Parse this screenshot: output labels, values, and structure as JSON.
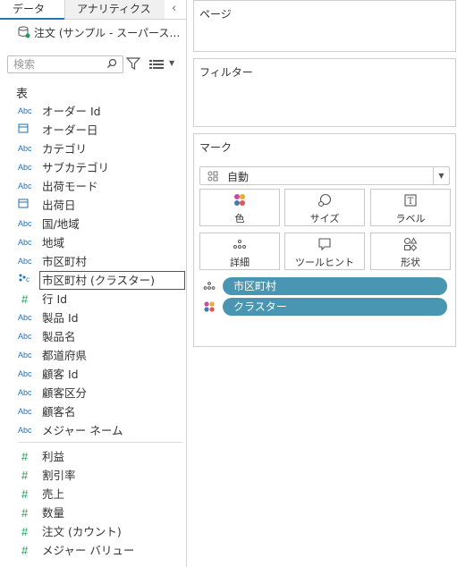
{
  "tabs": {
    "data": "データ",
    "analytics": "アナリティクス"
  },
  "data_source": "注文 (サンプル - スーパース…",
  "search": {
    "placeholder": "検索"
  },
  "section_table": "表",
  "dimensions": [
    {
      "type": "abc",
      "icon_text": "Abc",
      "label": "オーダー Id"
    },
    {
      "type": "date",
      "icon_text": "",
      "label": "オーダー日"
    },
    {
      "type": "abc",
      "icon_text": "Abc",
      "label": "カテゴリ"
    },
    {
      "type": "abc",
      "icon_text": "Abc",
      "label": "サブカテゴリ"
    },
    {
      "type": "abc",
      "icon_text": "Abc",
      "label": "出荷モード"
    },
    {
      "type": "date",
      "icon_text": "",
      "label": "出荷日"
    },
    {
      "type": "abc",
      "icon_text": "Abc",
      "label": "国/地域"
    },
    {
      "type": "abc",
      "icon_text": "Abc",
      "label": "地域"
    },
    {
      "type": "abc",
      "icon_text": "Abc",
      "label": "市区町村"
    },
    {
      "type": "cluster",
      "icon_text": "",
      "label": "市区町村 (クラスター)",
      "selected": true
    },
    {
      "type": "num",
      "icon_text": "#",
      "label": "行 Id"
    },
    {
      "type": "abc",
      "icon_text": "Abc",
      "label": "製品 Id"
    },
    {
      "type": "abc",
      "icon_text": "Abc",
      "label": "製品名"
    },
    {
      "type": "abc",
      "icon_text": "Abc",
      "label": "都道府県"
    },
    {
      "type": "abc",
      "icon_text": "Abc",
      "label": "顧客 Id"
    },
    {
      "type": "abc",
      "icon_text": "Abc",
      "label": "顧客区分"
    },
    {
      "type": "abc",
      "icon_text": "Abc",
      "label": "顧客名"
    },
    {
      "type": "abc",
      "icon_text": "Abc",
      "label": "メジャー ネーム"
    }
  ],
  "measures": [
    {
      "icon_text": "#",
      "label": "利益"
    },
    {
      "icon_text": "#",
      "label": "割引率"
    },
    {
      "icon_text": "#",
      "label": "売上"
    },
    {
      "icon_text": "#",
      "label": "数量"
    },
    {
      "icon_text": "#",
      "label": "注文 (カウント)"
    },
    {
      "icon_text": "#",
      "label": "メジャー バリュー"
    }
  ],
  "shelves": {
    "pages": "ページ",
    "filters": "フィルター",
    "marks": "マーク"
  },
  "mark_type": "自動",
  "mark_buttons": {
    "color": "色",
    "size": "サイズ",
    "label": "ラベル",
    "detail": "詳細",
    "tooltip": "ツールヒント",
    "shape": "形状"
  },
  "mark_pills": [
    {
      "type": "detail",
      "label": "市区町村"
    },
    {
      "type": "color",
      "label": "クラスター"
    }
  ],
  "colors": {
    "pill": "#4996b2",
    "dimension_icon": "#1f6fb5",
    "measure_icon": "#1d9c5a",
    "active_tab": "#1f77b4"
  }
}
